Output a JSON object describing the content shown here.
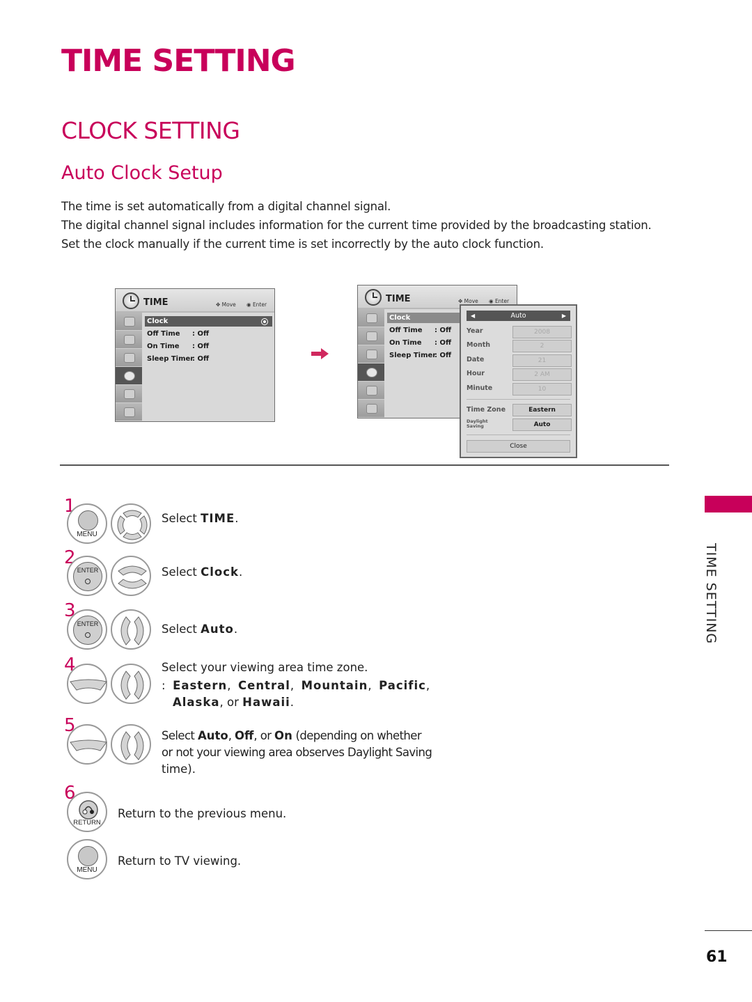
{
  "page": {
    "title": "TIME SETTING",
    "section": "CLOCK SETTING",
    "subsection": "Auto Clock Setup",
    "intro": [
      "The time is set automatically from a digital channel signal.",
      "The digital channel signal includes information for the current time provided by the broadcasting station.",
      "Set the clock manually if the current time is set incorrectly by the auto clock function."
    ],
    "side_tab_label": "TIME SETTING",
    "page_number": "61",
    "accent_color": "#c8005a"
  },
  "menu1": {
    "title": "TIME",
    "hint_move": "Move",
    "hint_enter": "Enter",
    "items": [
      {
        "label": "Clock",
        "value": ""
      },
      {
        "label": "Off Time",
        "value": ": Off"
      },
      {
        "label": "On Time",
        "value": ": Off"
      },
      {
        "label": "Sleep Timer",
        "value": ": Off"
      }
    ],
    "side_icons": [
      "picture-icon",
      "screen-icon",
      "audio-icon",
      "time-icon",
      "option-icon",
      "lock-icon"
    ]
  },
  "menu2": {
    "title": "TIME",
    "hint_move": "Move",
    "hint_enter": "Enter",
    "items": [
      {
        "label": "Clock",
        "value": ""
      },
      {
        "label": "Off Time",
        "value": ": Off"
      },
      {
        "label": "On Time",
        "value": ": Off"
      },
      {
        "label": "Sleep Timer",
        "value": ": Off"
      }
    ],
    "popup": {
      "mode": "Auto",
      "fields": [
        {
          "label": "Year",
          "value": "2008"
        },
        {
          "label": "Month",
          "value": "2"
        },
        {
          "label": "Date",
          "value": "21"
        },
        {
          "label": "Hour",
          "value": "2 AM"
        },
        {
          "label": "Minute",
          "value": "10"
        }
      ],
      "time_zone_label": "Time Zone",
      "time_zone_value": "Eastern",
      "daylight_label_1": "Daylight",
      "daylight_label_2": "Saving",
      "daylight_value": "Auto",
      "close_label": "Close"
    }
  },
  "steps": [
    {
      "num": "1",
      "button": "MENU",
      "text_pre": "Select ",
      "text_bold": "TIME",
      "text_post": "."
    },
    {
      "num": "2",
      "button": "ENTER",
      "text_pre": "Select ",
      "text_bold": "Clock",
      "text_post": "."
    },
    {
      "num": "3",
      "button": "ENTER",
      "text_pre": "Select ",
      "text_bold": "Auto",
      "text_post": "."
    },
    {
      "num": "4",
      "line1": "Select your viewing area time zone.",
      "zones": [
        "Eastern",
        "Central",
        "Mountain",
        "Pacific",
        "Alaska",
        "Hawaii"
      ],
      "or": "or"
    },
    {
      "num": "5",
      "options": [
        "Auto",
        "Off",
        "On"
      ],
      "or": "or",
      "tail1": "(depending on whether",
      "line2": "or not your viewing area observes Daylight Saving",
      "line3": "time)."
    },
    {
      "num": "6",
      "button": "RETURN",
      "text": "Return to the previous menu."
    },
    {
      "num": "",
      "button": "MENU",
      "text": "Return to TV viewing."
    }
  ]
}
